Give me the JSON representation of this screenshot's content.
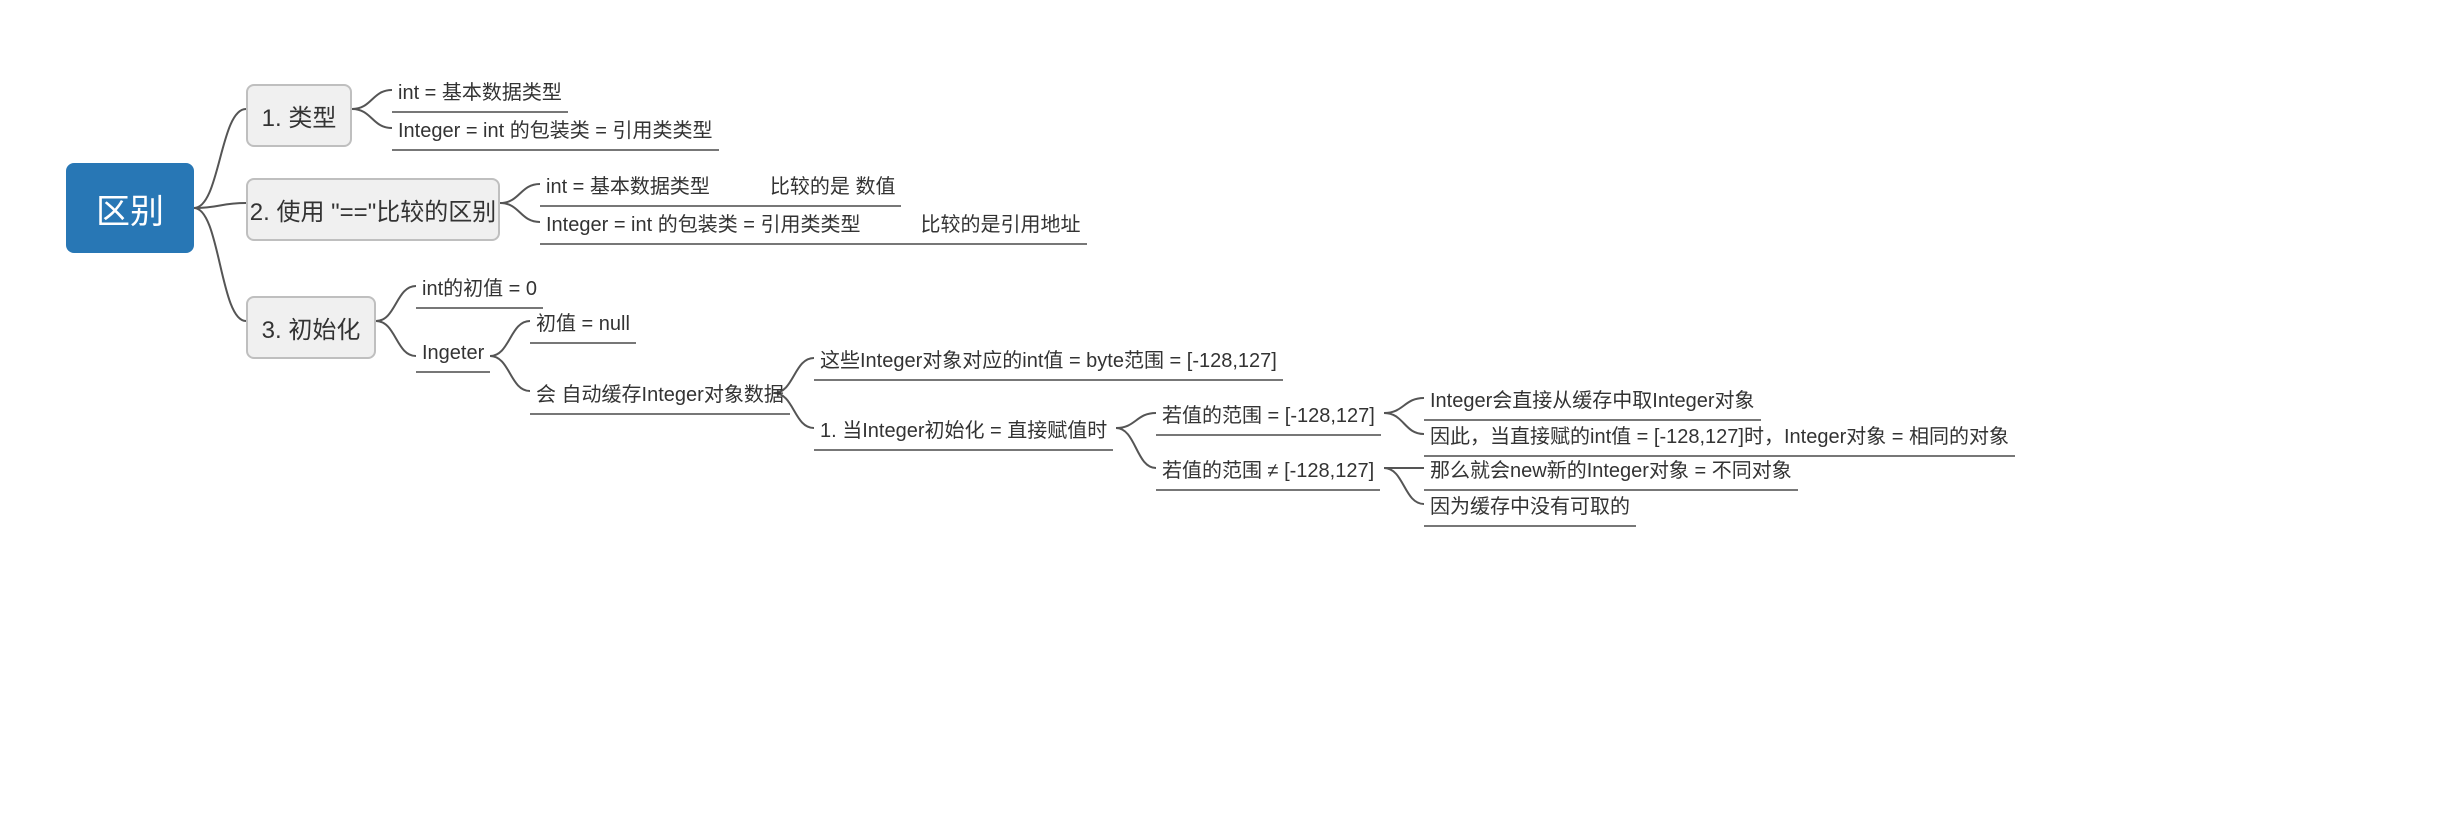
{
  "root": {
    "label": "区别"
  },
  "branch1": {
    "label": "1. 类型",
    "leaf1": "int = 基本数据类型",
    "leaf2": "Integer = int 的包装类 = 引用类类型"
  },
  "branch2": {
    "label": "2. 使用 \"==\"比较的区别",
    "leaf1a": "int = 基本数据类型",
    "leaf1b": "比较的是 数值",
    "leaf2a": "Integer = int 的包装类 = 引用类类型",
    "leaf2b": "比较的是引用地址"
  },
  "branch3": {
    "label": "3. 初始化",
    "leaf1": "int的初值 = 0",
    "leaf2": "Ingeter",
    "leaf2_1": "初值 = null",
    "leaf2_2": "会 自动缓存Integer对象数据",
    "leaf2_2_1": "这些Integer对象对应的int值 = byte范围 = [-128,127]",
    "leaf2_2_2": "1. 当Integer初始化 = 直接赋值时",
    "leaf2_2_2_1": "若值的范围 = [-128,127]",
    "leaf2_2_2_1_1": "Integer会直接从缓存中取Integer对象",
    "leaf2_2_2_1_2": "因此，当直接赋的int值 = [-128,127]时，Integer对象 = 相同的对象",
    "leaf2_2_2_2": "若值的范围 ≠ [-128,127]",
    "leaf2_2_2_2_1": "那么就会new新的Integer对象 = 不同对象",
    "leaf2_2_2_2_2": "因为缓存中没有可取的"
  }
}
